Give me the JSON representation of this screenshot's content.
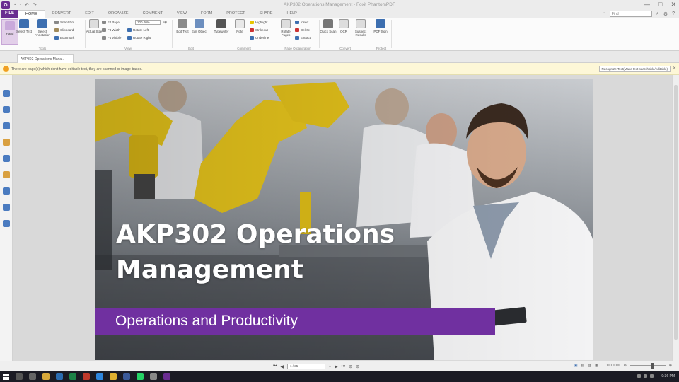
{
  "titlebar": {
    "app_icon": "G",
    "title": "AKP302 Operations Management - Foxit PhantomPDF",
    "quick_icons": [
      "save-icon",
      "print-icon",
      "undo-icon",
      "redo-icon"
    ],
    "controls": {
      "minimize": "—",
      "maximize": "□",
      "close": "✕"
    }
  },
  "menu": {
    "file": "FILE",
    "tabs": [
      "HOME",
      "CONVERT",
      "EDIT",
      "ORGANIZE",
      "COMMENT",
      "VIEW",
      "FORM",
      "PROTECT",
      "SHARE",
      "HELP"
    ],
    "find_placeholder": "Find"
  },
  "ribbon": {
    "tools": {
      "hand": "Hand",
      "select_text": "Select Text",
      "select_annotation": "Select Annotation",
      "snapshot": "SnapShot",
      "clipboard": "Clipboard",
      "bookmark": "Bookmark",
      "label": "Tools"
    },
    "view": {
      "actual_size": "Actual Size",
      "fit_page": "Fit Page",
      "fit_width": "Fit Width",
      "fit_visible": "Fit Visible",
      "zoom_value": "100.00%",
      "rotate_left": "Rotate Left",
      "rotate_right": "Rotate Right",
      "label": "View"
    },
    "edit": {
      "edit_text": "Edit Text",
      "edit_object": "Edit Object",
      "label": "Edit"
    },
    "comment": {
      "typewriter": "Typewriter",
      "note": "Note",
      "highlight": "Highlight",
      "strikeout": "Strikeout",
      "underline": "Underline",
      "label": "Comment"
    },
    "page_org": {
      "rotate_pages": "Rotate Pages",
      "insert": "Insert",
      "delete": "Delete",
      "extract": "Extract",
      "label": "Page Organization"
    },
    "convert": {
      "quick_scan": "Quick Scan",
      "ocr": "OCR",
      "suspect_results": "Suspect Results",
      "label": "Convert"
    },
    "protect": {
      "pdf_sign": "PDF Sign",
      "label": "Protect"
    }
  },
  "doc_tab": {
    "label": "AKP302 Operations Mana..."
  },
  "notification": {
    "text": "There are page(s) which don't have editable text, they are scanned or image-based.",
    "button": "Recognize Text(Make text searchable/editable)",
    "close": "✕"
  },
  "slide": {
    "title": "AKP302 Operations Management",
    "subtitle": "Operations and Productivity",
    "band_color": "#7030a0"
  },
  "statusbar": {
    "page_display": "1 / 35",
    "zoom": "100.00%"
  },
  "taskbar": {
    "time": "9:36 PM"
  },
  "colors": {
    "brand": "#6a2d91",
    "notify_bg": "#fdf7d7"
  }
}
